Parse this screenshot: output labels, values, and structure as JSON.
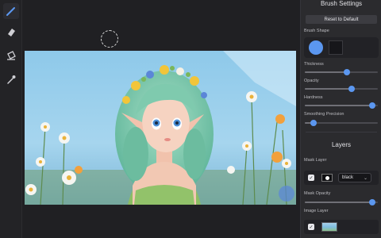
{
  "tools": [
    {
      "name": "brush",
      "icon": "brush-icon",
      "active": true
    },
    {
      "name": "eraser",
      "icon": "eraser-icon",
      "active": false
    },
    {
      "name": "fill",
      "icon": "paint-bucket-icon",
      "active": false
    },
    {
      "name": "picker",
      "icon": "eyedropper-icon",
      "active": false
    }
  ],
  "panel": {
    "title": "Brush Settings",
    "reset_label": "Reset to Default",
    "brush_shape_label": "Brush Shape",
    "brush_shape_selected": "round",
    "sliders": [
      {
        "label": "Thickness",
        "value": 0.58
      },
      {
        "label": "Opacity",
        "value": 0.64
      },
      {
        "label": "Hardness",
        "value": 0.92
      },
      {
        "label": "Smoothing Precision",
        "value": 0.12
      }
    ],
    "layers_title": "Layers",
    "mask_layer_label": "Mask Layer",
    "mask_layer_checked": true,
    "mask_color_value": "black",
    "mask_opacity_label": "Mask Opacity",
    "mask_opacity_value": 0.92,
    "image_layer_label": "Image Layer",
    "image_layer_checked": true
  },
  "colors": {
    "accent": "#5b97f0",
    "panel_bg": "#2b2b2e",
    "workspace_bg": "#202023"
  }
}
